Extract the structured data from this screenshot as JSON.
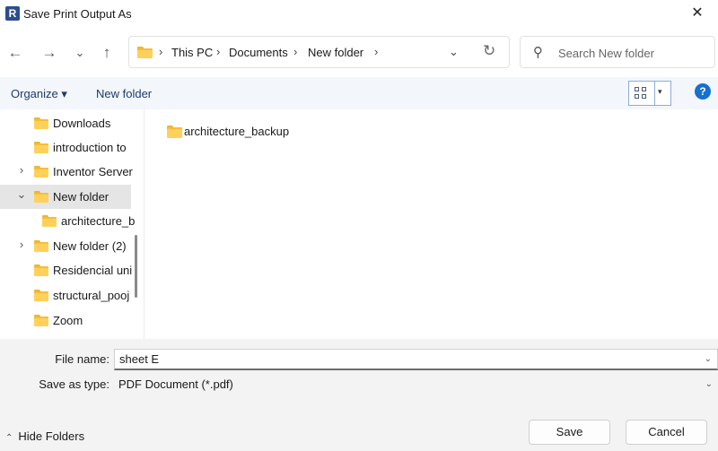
{
  "window": {
    "title": "Save Print Output As",
    "app_icon_letter": "R",
    "close_glyph": "✕"
  },
  "nav": {
    "back_glyph": "←",
    "forward_glyph": "→",
    "recent_glyph": "⌄",
    "up_glyph": "↑",
    "breadcrumbs": [
      "This PC",
      "Documents",
      "New folder"
    ],
    "separator": "›",
    "dropdown_glyph": "⌄",
    "refresh_glyph": "↻"
  },
  "search": {
    "placeholder": "Search New folder",
    "icon": "search-icon",
    "icon_glyph": "⚲"
  },
  "toolbar": {
    "organize_label": "Organize ▾",
    "new_folder_label": "New folder",
    "view_drop_glyph": "▾",
    "help_glyph": "?"
  },
  "sidebar": {
    "items": [
      {
        "label": "Downloads",
        "chevron": "",
        "indent": 0
      },
      {
        "label": "introduction to",
        "chevron": "",
        "indent": 0
      },
      {
        "label": "Inventor Server",
        "chevron": "›",
        "indent": 0
      },
      {
        "label": "New folder",
        "chevron": "⌄",
        "indent": 0,
        "selected": true
      },
      {
        "label": "architecture_b",
        "chevron": "",
        "indent": 1
      },
      {
        "label": "New folder (2)",
        "chevron": "›",
        "indent": 0
      },
      {
        "label": "Residencial uni",
        "chevron": "",
        "indent": 0
      },
      {
        "label": "structural_pooj",
        "chevron": "",
        "indent": 0
      },
      {
        "label": "Zoom",
        "chevron": "",
        "indent": 0
      }
    ]
  },
  "main": {
    "items": [
      {
        "label": "architecture_backup",
        "icon": "folder-icon"
      }
    ]
  },
  "form": {
    "file_name_label": "File name:",
    "file_name_value": "sheet E",
    "save_type_label": "Save as type:",
    "save_type_value": "PDF Document (*.pdf)",
    "chevron_glyph": "⌄"
  },
  "footer": {
    "hide_folders_label": "Hide Folders",
    "hide_folders_chevron": "⌃",
    "save_label": "Save",
    "cancel_label": "Cancel"
  }
}
